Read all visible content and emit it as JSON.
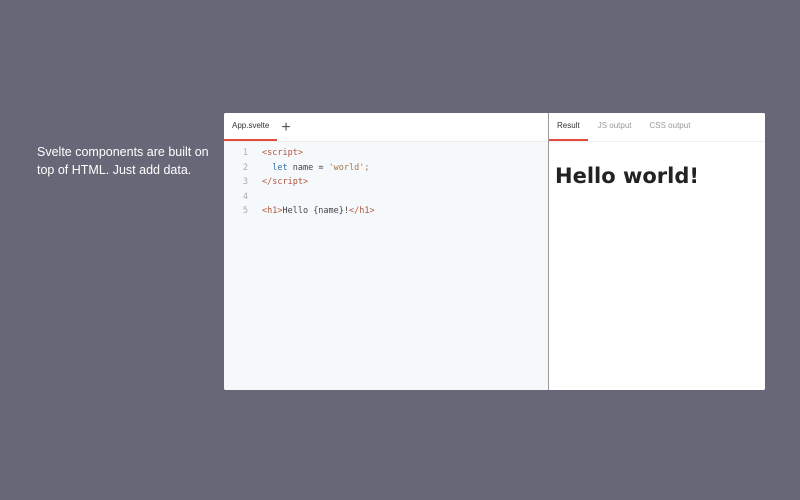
{
  "intro": "Svelte components are built on top of HTML. Just add data.",
  "editor": {
    "tab": "App.svelte",
    "add_label": "+",
    "lines": [
      {
        "n": "1",
        "a": "<script>",
        "b": "",
        "c": "",
        "d": ""
      },
      {
        "n": "2",
        "a": "",
        "b": "let",
        "c": " name = ",
        "d": "'world';"
      },
      {
        "n": "3",
        "a": "</script>",
        "b": "",
        "c": "",
        "d": ""
      },
      {
        "n": "4",
        "a": "",
        "b": "",
        "c": "",
        "d": ""
      },
      {
        "n": "5",
        "a": "<h1>",
        "b": "",
        "c": "Hello {name}!",
        "d": "</h1>"
      }
    ]
  },
  "output": {
    "tabs": [
      "Result",
      "JS output",
      "CSS output"
    ],
    "result_heading": "Hello world!"
  }
}
